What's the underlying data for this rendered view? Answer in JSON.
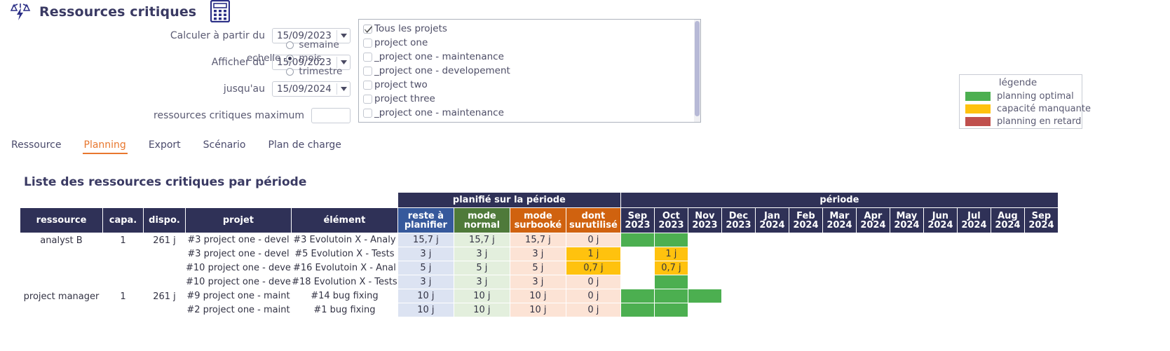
{
  "header": {
    "title": "Ressources critiques",
    "logo_icon": "scales-lightning-icon",
    "calculator_icon": "calculator-icon"
  },
  "form": {
    "fields": [
      {
        "label": "Calculer à partir du",
        "value": "15/09/2023",
        "name": "calculer-a-partir-du"
      },
      {
        "label": "Afficher du",
        "value": "15/09/2023",
        "name": "afficher-du"
      },
      {
        "label": "jusqu'au",
        "value": "15/09/2024",
        "name": "jusquau"
      }
    ],
    "max_label": "ressources critiques maximum",
    "max_value": "",
    "echelle_label": "echelle",
    "echelle_options": [
      {
        "label": "semaine",
        "selected": false
      },
      {
        "label": "mois",
        "selected": true
      },
      {
        "label": "trimestre",
        "selected": false
      }
    ]
  },
  "projects": [
    {
      "label": "Tous les projets",
      "checked": true
    },
    {
      "label": "project one",
      "checked": false
    },
    {
      "label": "_project one - maintenance",
      "checked": false
    },
    {
      "label": "_project one - developement",
      "checked": false
    },
    {
      "label": "project two",
      "checked": false
    },
    {
      "label": "project three",
      "checked": false
    },
    {
      "label": "_project one - maintenance",
      "checked": false
    }
  ],
  "legend": {
    "title": "légende",
    "items": [
      {
        "label": "planning optimal",
        "color": "#4caf50"
      },
      {
        "label": "capacité manquante",
        "color": "#ffc20e"
      },
      {
        "label": "planning en retard",
        "color": "#c0504d"
      }
    ]
  },
  "tabs": [
    {
      "label": "Ressource",
      "active": false
    },
    {
      "label": "Planning",
      "active": true
    },
    {
      "label": "Export",
      "active": false
    },
    {
      "label": "Scénario",
      "active": false
    },
    {
      "label": "Plan de charge",
      "active": false
    }
  ],
  "section_title": "Liste des ressources critiques par période",
  "table": {
    "group_headers": {
      "planifie": "planifié sur la période",
      "periode": "période"
    },
    "columns": [
      {
        "key": "ressource",
        "label": "ressource"
      },
      {
        "key": "capa",
        "label": "capa."
      },
      {
        "key": "dispo",
        "label": "dispo."
      },
      {
        "key": "projet",
        "label": "projet"
      },
      {
        "key": "element",
        "label": "élément"
      },
      {
        "key": "reste",
        "label": "reste à\nplanifier"
      },
      {
        "key": "normal",
        "label": "mode\nnormal"
      },
      {
        "key": "surbooke",
        "label": "mode\nsurbooké"
      },
      {
        "key": "surutilise",
        "label": "dont\nsurutilisé"
      }
    ],
    "col_labels": {
      "reste_l1": "reste à",
      "reste_l2": "planifier",
      "normal_l1": "mode",
      "normal_l2": "normal",
      "surbooke_l1": "mode",
      "surbooke_l2": "surbooké",
      "surutilise_l1": "dont",
      "surutilise_l2": "surutilisé"
    },
    "months": [
      {
        "m": "Sep",
        "y": "2023"
      },
      {
        "m": "Oct",
        "y": "2023"
      },
      {
        "m": "Nov",
        "y": "2023"
      },
      {
        "m": "Dec",
        "y": "2023"
      },
      {
        "m": "Jan",
        "y": "2024"
      },
      {
        "m": "Feb",
        "y": "2024"
      },
      {
        "m": "Mar",
        "y": "2024"
      },
      {
        "m": "Apr",
        "y": "2024"
      },
      {
        "m": "May",
        "y": "2024"
      },
      {
        "m": "Jun",
        "y": "2024"
      },
      {
        "m": "Jul",
        "y": "2024"
      },
      {
        "m": "Aug",
        "y": "2024"
      },
      {
        "m": "Sep",
        "y": "2024"
      }
    ],
    "rows": [
      {
        "ressource": "analyst B",
        "capa": "1",
        "dispo": "261 j",
        "rowspan": 4,
        "projet": "#3 project one - devel",
        "element": "#3 Evolutoin X - Analy",
        "reste": "15,7 j",
        "normal": "15,7 j",
        "surbooke": "15,7 j",
        "surutilise": "0 j",
        "cells": [
          {
            "state": "ok",
            "value": ""
          },
          {
            "state": "ok",
            "value": ""
          },
          {
            "state": "empty",
            "value": ""
          },
          {
            "state": "empty",
            "value": ""
          },
          {
            "state": "empty",
            "value": ""
          },
          {
            "state": "empty",
            "value": ""
          },
          {
            "state": "empty",
            "value": ""
          },
          {
            "state": "empty",
            "value": ""
          },
          {
            "state": "empty",
            "value": ""
          },
          {
            "state": "empty",
            "value": ""
          },
          {
            "state": "empty",
            "value": ""
          },
          {
            "state": "empty",
            "value": ""
          },
          {
            "state": "empty",
            "value": ""
          }
        ]
      },
      {
        "ressource": "",
        "capa": "",
        "dispo": "",
        "projet": "#3 project one - devel",
        "element": "#5 Evolution X - Tests",
        "reste": "3 j",
        "normal": "3 j",
        "surbooke": "3 j",
        "surutilise": "1 j",
        "cells": [
          {
            "state": "empty",
            "value": ""
          },
          {
            "state": "warn",
            "value": "1 j"
          },
          {
            "state": "empty",
            "value": ""
          },
          {
            "state": "empty",
            "value": ""
          },
          {
            "state": "empty",
            "value": ""
          },
          {
            "state": "empty",
            "value": ""
          },
          {
            "state": "empty",
            "value": ""
          },
          {
            "state": "empty",
            "value": ""
          },
          {
            "state": "empty",
            "value": ""
          },
          {
            "state": "empty",
            "value": ""
          },
          {
            "state": "empty",
            "value": ""
          },
          {
            "state": "empty",
            "value": ""
          },
          {
            "state": "empty",
            "value": ""
          }
        ]
      },
      {
        "ressource": "",
        "capa": "",
        "dispo": "",
        "projet": "#10 project one - deve",
        "element": "#16 Evolutoin X - Anal",
        "reste": "5 j",
        "normal": "5 j",
        "surbooke": "5 j",
        "surutilise": "0,7 j",
        "cells": [
          {
            "state": "empty",
            "value": ""
          },
          {
            "state": "warn",
            "value": "0,7 j"
          },
          {
            "state": "empty",
            "value": ""
          },
          {
            "state": "empty",
            "value": ""
          },
          {
            "state": "empty",
            "value": ""
          },
          {
            "state": "empty",
            "value": ""
          },
          {
            "state": "empty",
            "value": ""
          },
          {
            "state": "empty",
            "value": ""
          },
          {
            "state": "empty",
            "value": ""
          },
          {
            "state": "empty",
            "value": ""
          },
          {
            "state": "empty",
            "value": ""
          },
          {
            "state": "empty",
            "value": ""
          },
          {
            "state": "empty",
            "value": ""
          }
        ]
      },
      {
        "ressource": "",
        "capa": "",
        "dispo": "",
        "projet": "#10 project one - deve",
        "element": "#18 Evolution X - Tests",
        "reste": "3 j",
        "normal": "3 j",
        "surbooke": "3 j",
        "surutilise": "0 j",
        "cells": [
          {
            "state": "empty",
            "value": ""
          },
          {
            "state": "ok",
            "value": ""
          },
          {
            "state": "empty",
            "value": ""
          },
          {
            "state": "empty",
            "value": ""
          },
          {
            "state": "empty",
            "value": ""
          },
          {
            "state": "empty",
            "value": ""
          },
          {
            "state": "empty",
            "value": ""
          },
          {
            "state": "empty",
            "value": ""
          },
          {
            "state": "empty",
            "value": ""
          },
          {
            "state": "empty",
            "value": ""
          },
          {
            "state": "empty",
            "value": ""
          },
          {
            "state": "empty",
            "value": ""
          },
          {
            "state": "empty",
            "value": ""
          }
        ]
      },
      {
        "ressource": "project manager",
        "capa": "1",
        "dispo": "261 j",
        "rowspan": 2,
        "projet": "#9 project one - maint",
        "element": "#14 bug fixing",
        "reste": "10 j",
        "normal": "10 j",
        "surbooke": "10 j",
        "surutilise": "0 j",
        "cells": [
          {
            "state": "ok",
            "value": ""
          },
          {
            "state": "ok",
            "value": ""
          },
          {
            "state": "ok",
            "value": ""
          },
          {
            "state": "empty",
            "value": ""
          },
          {
            "state": "empty",
            "value": ""
          },
          {
            "state": "empty",
            "value": ""
          },
          {
            "state": "empty",
            "value": ""
          },
          {
            "state": "empty",
            "value": ""
          },
          {
            "state": "empty",
            "value": ""
          },
          {
            "state": "empty",
            "value": ""
          },
          {
            "state": "empty",
            "value": ""
          },
          {
            "state": "empty",
            "value": ""
          },
          {
            "state": "empty",
            "value": ""
          }
        ]
      },
      {
        "ressource": "",
        "capa": "",
        "dispo": "",
        "projet": "#2 project one - maint",
        "element": "#1 bug fixing",
        "reste": "10 j",
        "normal": "10 j",
        "surbooke": "10 j",
        "surutilise": "0 j",
        "cells": [
          {
            "state": "ok",
            "value": ""
          },
          {
            "state": "ok",
            "value": ""
          },
          {
            "state": "empty",
            "value": ""
          },
          {
            "state": "empty",
            "value": ""
          },
          {
            "state": "empty",
            "value": ""
          },
          {
            "state": "empty",
            "value": ""
          },
          {
            "state": "empty",
            "value": ""
          },
          {
            "state": "empty",
            "value": ""
          },
          {
            "state": "empty",
            "value": ""
          },
          {
            "state": "empty",
            "value": ""
          },
          {
            "state": "empty",
            "value": ""
          },
          {
            "state": "empty",
            "value": ""
          },
          {
            "state": "empty",
            "value": ""
          }
        ]
      }
    ]
  },
  "colors": {
    "header_dark": "#2f3157",
    "blue": "#36599c",
    "green": "#4f7a3a",
    "orange": "#d0620f",
    "accent": "#e8772e",
    "ok": "#4caf50",
    "warn": "#ffc20e",
    "late": "#c0504d"
  }
}
